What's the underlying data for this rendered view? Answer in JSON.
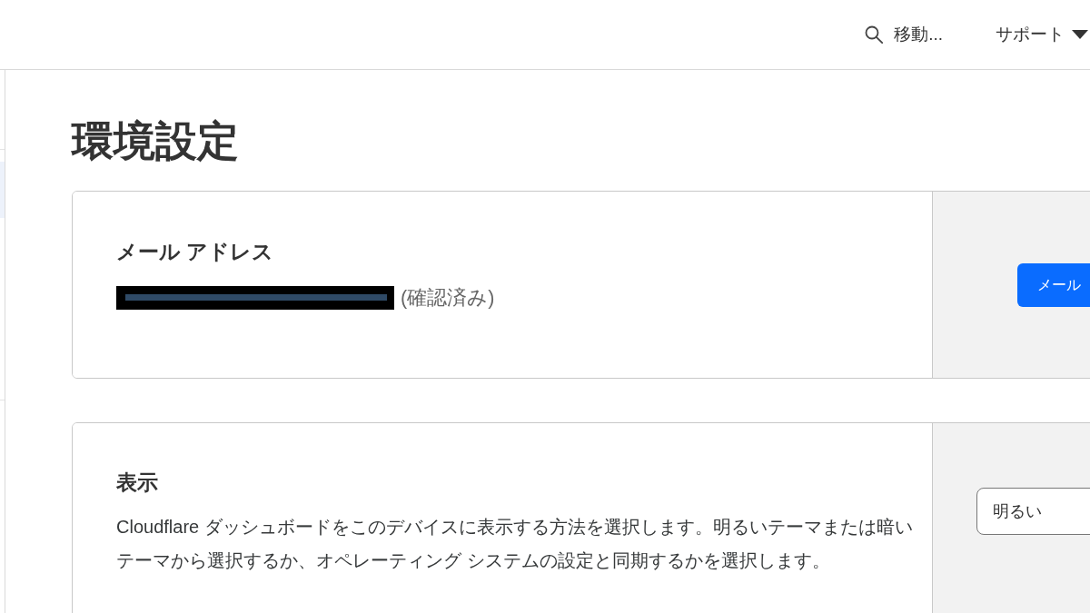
{
  "header": {
    "search": {
      "label": "移動..."
    },
    "support_menu": {
      "label": "サポート"
    }
  },
  "page_title": "環境設定",
  "sections": [
    {
      "kind": "email",
      "title": "メール アドレス",
      "status": "(確認済み)",
      "button": "メール"
    },
    {
      "kind": "display",
      "title": "表示",
      "description": "Cloudflare ダッシュボードをこのデバイスに表示する方法を選択します。明るいテーマまたは暗いテーマから選択するか、オペレーティング システムの設定と同期するかを選択します。",
      "select": {
        "value": "明るい"
      }
    }
  ]
}
